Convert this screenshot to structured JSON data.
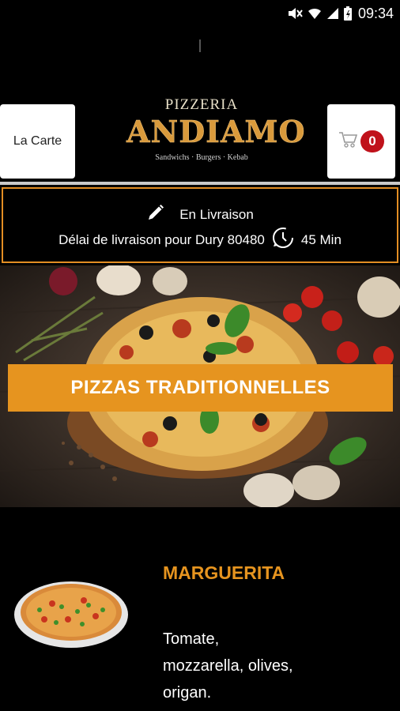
{
  "status_bar": {
    "time": "09:34"
  },
  "header": {
    "menu_label": "La Carte",
    "cart_count": "0",
    "logo": {
      "line1": "PIZZERIA",
      "line2": "ANDIAMO",
      "line3": "Sandwichs · Burgers · Kebab"
    }
  },
  "delivery": {
    "mode": "En Livraison",
    "delay_text": "Délai de livraison pour Dury 80480",
    "delay_value": "45 Min"
  },
  "category": {
    "title": "PIZZAS TRADITIONNELLES"
  },
  "product": {
    "name": "MARGUERITA",
    "description": "Tomate, mozzarella, olives, origan."
  },
  "colors": {
    "accent": "#e6941f",
    "badge": "#c0121b",
    "background": "#000000"
  },
  "icons": [
    "mute-icon",
    "wifi-icon",
    "signal-icon",
    "battery-icon",
    "cart-icon",
    "pencil-icon",
    "clock-icon"
  ]
}
